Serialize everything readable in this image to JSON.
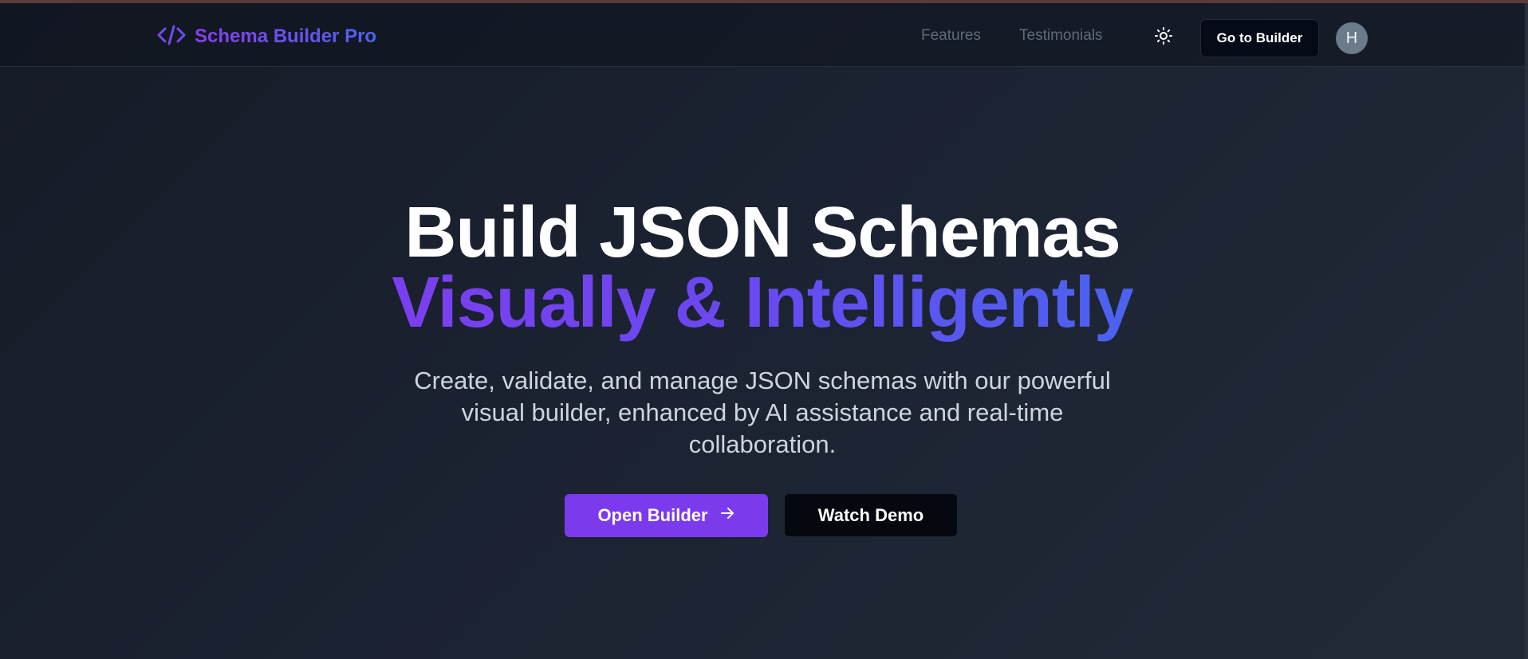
{
  "brand": {
    "name": "Schema Builder Pro",
    "icon": "code-icon"
  },
  "nav": {
    "links": [
      {
        "label": "Features"
      },
      {
        "label": "Testimonials"
      }
    ],
    "theme_icon": "sun-icon",
    "builder_button": "Go to Builder",
    "avatar_initial": "H"
  },
  "hero": {
    "title_line1": "Build JSON Schemas",
    "title_line2": "Visually & Intelligently",
    "subtitle_line1": "Create, validate, and manage JSON schemas with our powerful",
    "subtitle_line2": "visual builder, enhanced by AI assistance and real-time",
    "subtitle_line3": "collaboration.",
    "primary_button": "Open Builder",
    "primary_button_icon": "arrow-right-icon",
    "secondary_button": "Watch Demo"
  },
  "colors": {
    "accent": "#7c3aed",
    "gradient_start": "#7b3ff0",
    "gradient_end": "#4b63ef",
    "background": "#1b2231"
  }
}
